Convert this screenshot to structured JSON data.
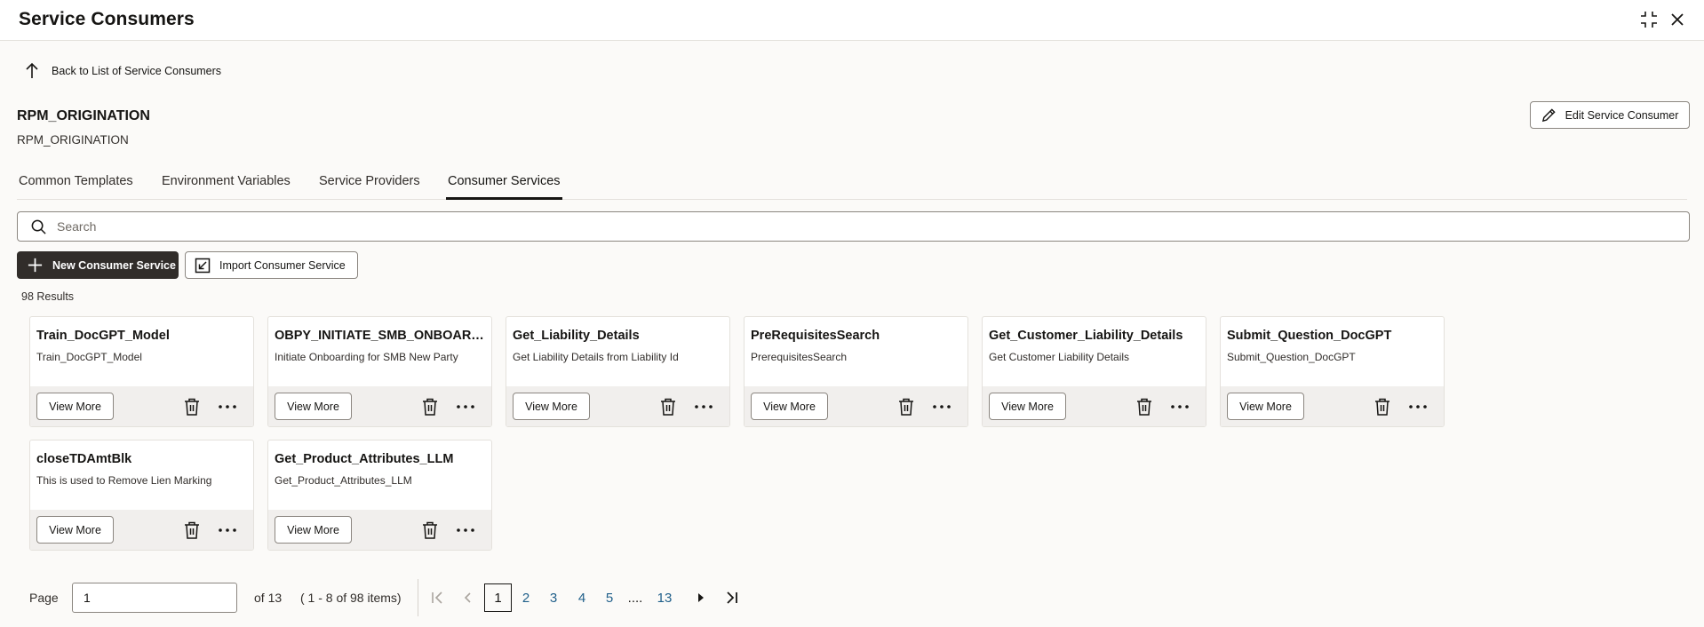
{
  "window": {
    "title": "Service Consumers",
    "icons": [
      "collapse-icon",
      "close-icon"
    ]
  },
  "back_link": {
    "label": "Back to List of Service Consumers"
  },
  "entity": {
    "name": "RPM_ORIGINATION",
    "subtitle": "RPM_ORIGINATION"
  },
  "edit_button": {
    "label": "Edit Service Consumer"
  },
  "tabs": [
    {
      "label": "Common Templates"
    },
    {
      "label": "Environment Variables"
    },
    {
      "label": "Service Providers"
    },
    {
      "label": "Consumer Services",
      "active": true
    }
  ],
  "search": {
    "placeholder": "Search",
    "value": ""
  },
  "actions": {
    "new_label": "New Consumer Service",
    "import_label": "Import Consumer Service"
  },
  "results_text": "98 Results",
  "cards": [
    {
      "title": "Train_DocGPT_Model",
      "description": "Train_DocGPT_Model",
      "button": "View More"
    },
    {
      "title": "OBPY_INITIATE_SMB_ONBOARDING",
      "description": "Initiate Onboarding for SMB New Party",
      "button": "View More"
    },
    {
      "title": "Get_Liability_Details",
      "description": "Get Liability Details from Liability Id",
      "button": "View More"
    },
    {
      "title": "PreRequisitesSearch",
      "description": "PrerequisitesSearch",
      "button": "View More"
    },
    {
      "title": "Get_Customer_Liability_Details",
      "description": "Get Customer Liability Details",
      "button": "View More"
    },
    {
      "title": "Submit_Question_DocGPT",
      "description": "Submit_Question_DocGPT",
      "button": "View More"
    },
    {
      "title": "closeTDAmtBlk",
      "description": "This is used to Remove Lien Marking",
      "button": "View More"
    },
    {
      "title": "Get_Product_Attributes_LLM",
      "description": "Get_Product_Attributes_LLM",
      "button": "View More"
    }
  ],
  "pagination": {
    "page_label": "Page",
    "page_value": "1",
    "of_label": "of 13",
    "range_label": "( 1 - 8 of 98 items)",
    "pages": [
      "1",
      "2",
      "3",
      "4",
      "5",
      "....",
      "13"
    ],
    "current_page": "1"
  },
  "colors": {
    "primary_button": "#312d2a",
    "link": "#1f5f8a",
    "background": "#fbfaf8"
  }
}
